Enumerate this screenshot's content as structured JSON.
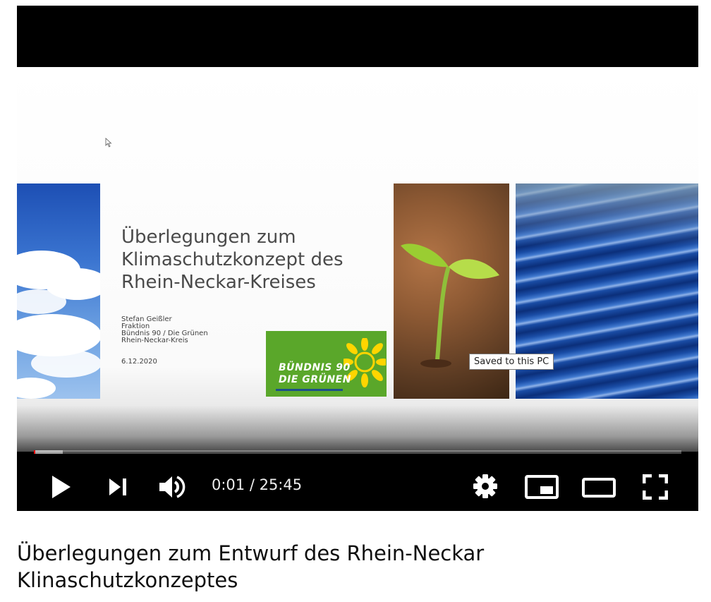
{
  "slide": {
    "title": "Überlegungen zum Klimaschutzkonzept des Rhein-Neckar-Kreises",
    "author_lines": [
      "Stefan Geißler",
      "Fraktion",
      "Bündnis 90 / Die Grünen",
      "Rhein-Neckar-Kreis"
    ],
    "date": "6.12.2020",
    "logo_line1": "BÜNDNIS 90",
    "logo_line2": "DIE GRÜNEN"
  },
  "tooltip": "Saved to this PC",
  "player": {
    "time_display": "0:01 / 25:45",
    "progress_fraction": 0.0006,
    "loaded_fraction": 0.045
  },
  "video_title": "Überlegungen zum Entwurf des Rhein-Neckar Klinaschutzkonzeptes",
  "icons": {
    "play": "play-icon",
    "next": "next-icon",
    "volume": "volume-icon",
    "settings": "gear-icon",
    "miniplayer": "miniplayer-icon",
    "theater": "theater-mode-icon",
    "fullscreen": "fullscreen-icon"
  },
  "colors": {
    "progress": "#ff0000",
    "logo_green": "#5aa72a",
    "sunflower": "#ffd500"
  }
}
